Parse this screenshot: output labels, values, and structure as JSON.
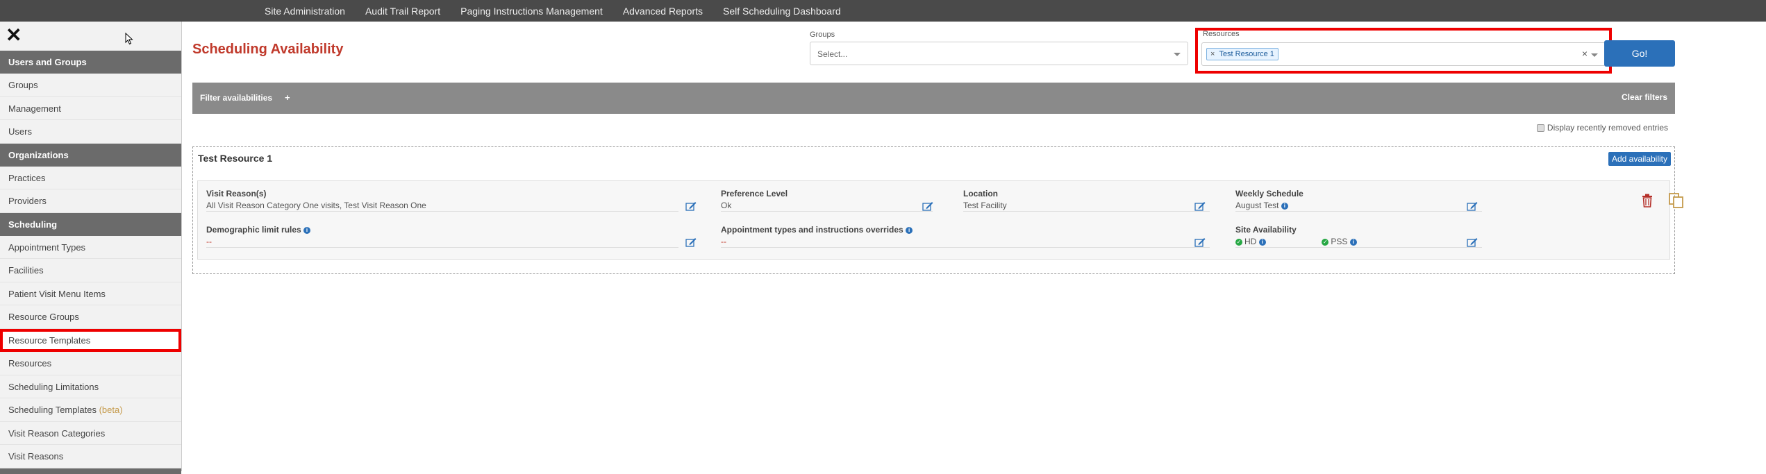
{
  "topnav": [
    "Site Administration",
    "Audit Trail Report",
    "Paging Instructions Management",
    "Advanced Reports",
    "Self Scheduling Dashboard"
  ],
  "sidebar": {
    "sections": [
      {
        "header": "Users and Groups",
        "items": [
          "Groups",
          "Management",
          "Users"
        ]
      },
      {
        "header": "Organizations",
        "items": [
          "Practices",
          "Providers"
        ]
      },
      {
        "header": "Scheduling",
        "items": [
          "Appointment Types",
          "Facilities",
          "Patient Visit Menu Items",
          "Resource Groups",
          "Resource Templates",
          "Resources",
          "Scheduling Limitations",
          "Scheduling Templates",
          "Visit Reason Categories",
          "Visit Reasons"
        ]
      }
    ],
    "beta_label": "(beta)",
    "selected_item": "Resource Templates"
  },
  "page": {
    "title": "Scheduling Availability",
    "groups_label": "Groups",
    "groups_placeholder": "Select...",
    "resources_label": "Resources",
    "resource_tag": "Test Resource 1",
    "tag_remove": "×",
    "clear_x": "×",
    "go_label": "Go!",
    "filter_label": "Filter availabilities",
    "filter_plus": "+",
    "clear_filters": "Clear filters",
    "recent_label": "Display recently removed entries"
  },
  "resource": {
    "name": "Test Resource 1",
    "add_label": "Add availability",
    "visit_reasons_label": "Visit Reason(s)",
    "visit_reasons_value": "All Visit Reason Category One visits, Test Visit Reason One",
    "preference_label": "Preference Level",
    "preference_value": "Ok",
    "location_label": "Location",
    "location_value": "Test Facility",
    "weekly_label": "Weekly Schedule",
    "weekly_value": "August Test",
    "demographic_label": "Demographic limit rules",
    "demographic_value": "--",
    "overrides_label": "Appointment types and instructions overrides",
    "overrides_value": "--",
    "site_label": "Site Availability",
    "site_hd": "HD",
    "site_pss": "PSS"
  },
  "colors": {
    "accent_title": "#c0392b",
    "primary_button": "#2b70b9",
    "highlight_box": "#ee0000"
  }
}
